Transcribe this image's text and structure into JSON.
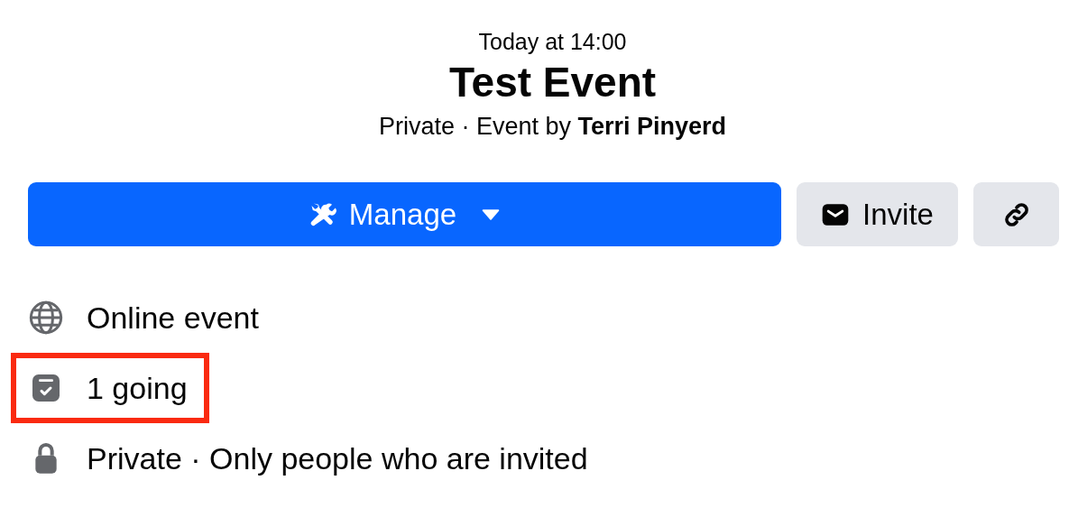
{
  "event": {
    "date": "Today at 14:00",
    "title": "Test Event",
    "subtitle": "Private · Event by **Terri Pinyerd**"
  },
  "actions": [
    {
      "kind": "manage",
      "label": "Manage"
    },
    {
      "kind": "invite",
      "label": "Invite"
    },
    {
      "kind": "link"
    }
  ],
  "details": [
    {
      "kind": "globe",
      "text": "Online event",
      "highlighted": false
    },
    {
      "kind": "going",
      "text": "1 going",
      "highlighted": true
    },
    {
      "kind": "lock",
      "text": "Private · Only people who are invited",
      "highlighted": false
    }
  ]
}
